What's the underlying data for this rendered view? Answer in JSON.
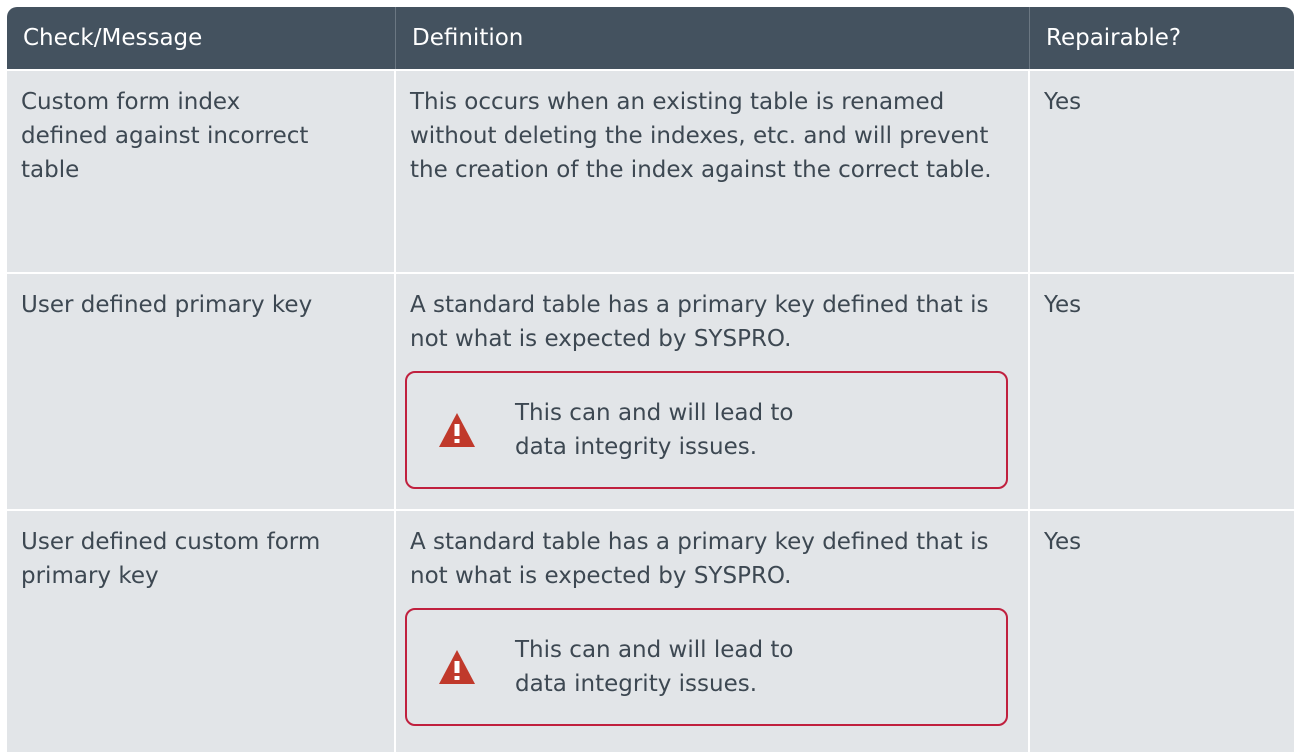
{
  "table": {
    "headers": [
      "Check/Message",
      "Definition",
      "Repairable?"
    ],
    "rows": [
      {
        "check": "Custom form index\ndefined against incorrect\ntable",
        "definition": "This occurs when an existing table is renamed without deleting the indexes, etc. and will prevent the creation of the index against the correct table.",
        "repairable": "Yes"
      },
      {
        "check": "User defined primary key",
        "definition": "A standard table has a primary key defined that is not what is expected by SYSPRO.",
        "note": "This can and will lead to\ndata integrity issues.",
        "repairable": "Yes"
      },
      {
        "check": "User defined custom form\nprimary key",
        "definition": "A standard table has a primary key defined that is not what is expected by SYSPRO.",
        "note": "This can and will lead to\ndata integrity issues.",
        "repairable": "Yes"
      }
    ]
  },
  "colors": {
    "header_bg": "#44525f",
    "row_bg": "#e2e5e8",
    "warning": "#c0203e",
    "text": "#3d4852"
  },
  "icons": {
    "note": "warning-triangle-icon"
  }
}
